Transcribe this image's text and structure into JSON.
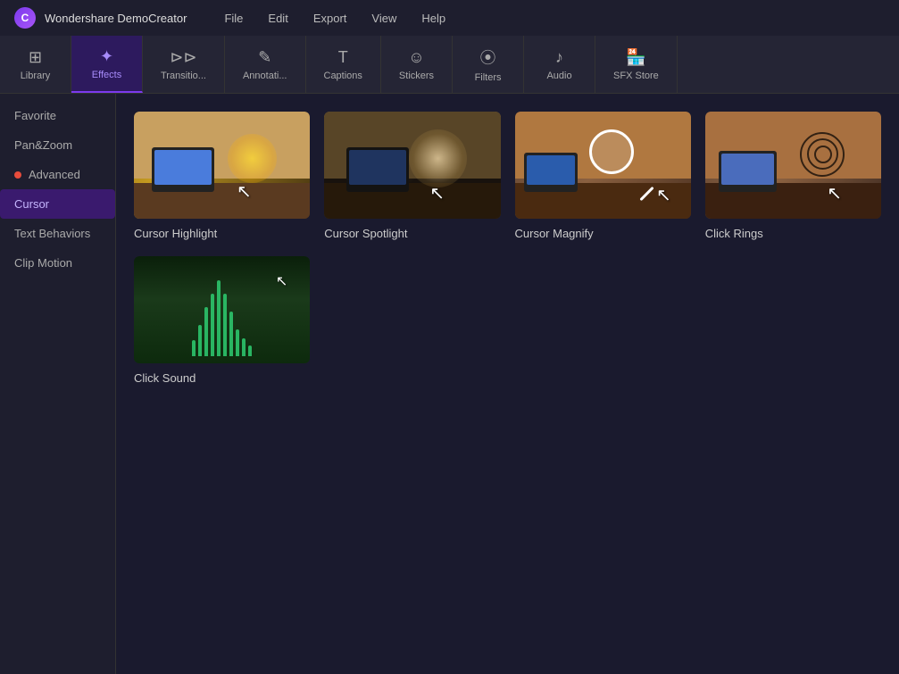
{
  "app": {
    "title": "Wondershare DemoCreator",
    "logo_letter": "C"
  },
  "menu": {
    "items": [
      "File",
      "Edit",
      "Export",
      "View",
      "Help"
    ]
  },
  "toolbar": {
    "items": [
      {
        "id": "library",
        "label": "Library",
        "icon": "⊞"
      },
      {
        "id": "effects",
        "label": "Effects",
        "icon": "✦",
        "active": true
      },
      {
        "id": "transitions",
        "label": "Transitio...",
        "icon": "⊳⊳"
      },
      {
        "id": "annotations",
        "label": "Annotati...",
        "icon": "✎"
      },
      {
        "id": "captions",
        "label": "Captions",
        "icon": "T"
      },
      {
        "id": "stickers",
        "label": "Stickers",
        "icon": "☺"
      },
      {
        "id": "filters",
        "label": "Filters",
        "icon": "⦿"
      },
      {
        "id": "audio",
        "label": "Audio",
        "icon": "♪"
      },
      {
        "id": "sfx_store",
        "label": "SFX Store",
        "icon": "🏪"
      }
    ]
  },
  "sidebar": {
    "items": [
      {
        "id": "favorite",
        "label": "Favorite",
        "has_dot": false
      },
      {
        "id": "pan_zoom",
        "label": "Pan&Zoom",
        "has_dot": false
      },
      {
        "id": "advanced",
        "label": "Advanced",
        "has_dot": true
      },
      {
        "id": "cursor",
        "label": "Cursor",
        "active": true,
        "has_dot": false
      },
      {
        "id": "text_behaviors",
        "label": "Text Behaviors",
        "has_dot": false
      },
      {
        "id": "clip_motion",
        "label": "Clip Motion",
        "has_dot": false
      }
    ]
  },
  "effects": {
    "cards": [
      {
        "id": "cursor_highlight",
        "label": "Cursor Highlight"
      },
      {
        "id": "cursor_spotlight",
        "label": "Cursor Spotlight"
      },
      {
        "id": "cursor_magnify",
        "label": "Cursor Magnify"
      },
      {
        "id": "click_rings",
        "label": "Click Rings"
      },
      {
        "id": "click_sound",
        "label": "Click Sound"
      }
    ]
  },
  "colors": {
    "active_sidebar_bg": "#3a1a6e",
    "active_tab_bg": "#2d1a5e",
    "accent": "#7c3aed",
    "green": "#2ecc71"
  }
}
